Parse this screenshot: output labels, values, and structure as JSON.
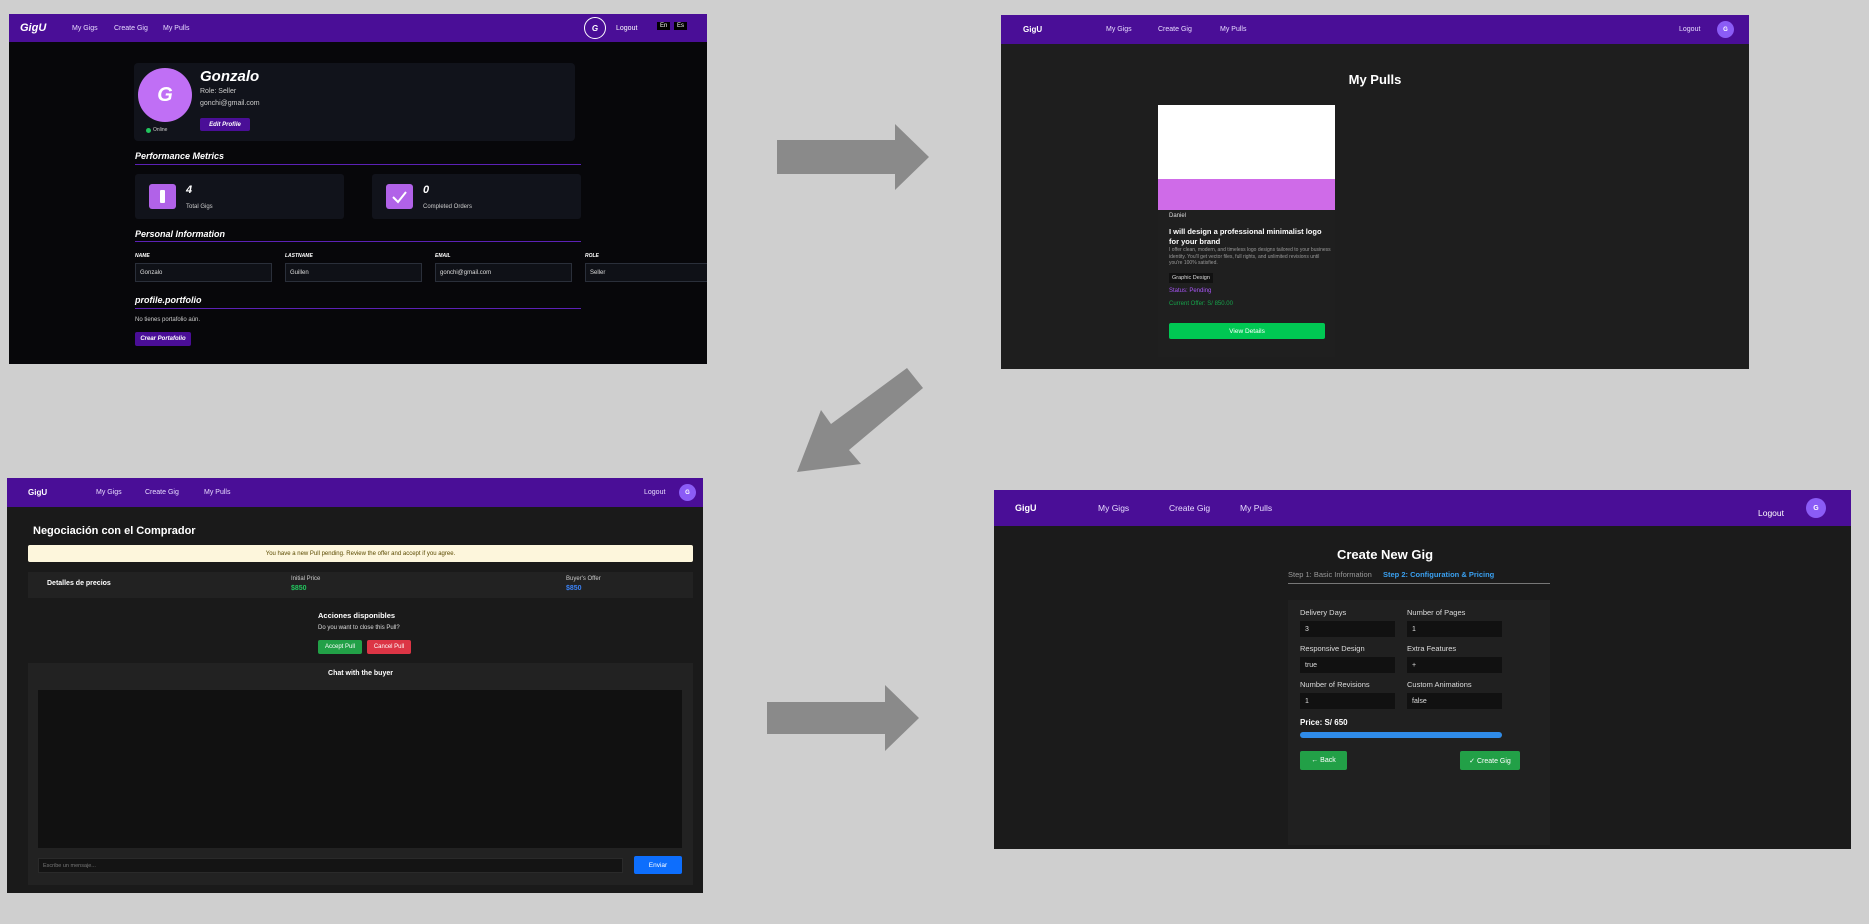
{
  "panel1": {
    "brand": "GigU",
    "nav": [
      "My Gigs",
      "Create Gig",
      "My Pulls"
    ],
    "avatar_letter": "G",
    "logout": "Logout",
    "lang_en": "En",
    "lang_es": "Es",
    "profile": {
      "avatar_letter": "G",
      "name": "Gonzalo",
      "role": "Role: Seller",
      "email": "gonchi@gmail.com",
      "status": "Online",
      "edit_button": "Edit Profile"
    },
    "metrics_title": "Performance Metrics",
    "metrics": [
      {
        "value": "4",
        "label": "Total Gigs"
      },
      {
        "value": "0",
        "label": "Completed Orders"
      }
    ],
    "personal_title": "Personal Information",
    "fields": [
      {
        "label": "NAME",
        "value": "Gonzalo"
      },
      {
        "label": "LASTNAME",
        "value": "Guillen"
      },
      {
        "label": "EMAIL",
        "value": "gonchi@gmail.com"
      },
      {
        "label": "ROLE",
        "value": "Seller"
      }
    ],
    "portfolio_title": "profile.portfolio",
    "portfolio_empty": "No tienes portafolio aún.",
    "portfolio_button": "Crear Portafolio"
  },
  "panel2": {
    "brand": "GigU",
    "nav": [
      "My Gigs",
      "Create Gig",
      "My Pulls"
    ],
    "logout": "Logout",
    "avatar_letter": "G",
    "title": "My Pulls",
    "card": {
      "seller": "Daniel",
      "title": "I will design a professional minimalist logo for your brand",
      "description": "I offer clean, modern, and timeless logo designs tailored to your business identity. You'll get vector files, full rights, and unlimited revisions until you're 100% satisfied.",
      "tag": "Graphic Design",
      "status": "Status: Pending",
      "offer": "Current Offer: S/ 850.00",
      "button": "View Details"
    }
  },
  "panel3": {
    "brand": "GigU",
    "nav": [
      "My Gigs",
      "Create Gig",
      "My Pulls"
    ],
    "logout": "Logout",
    "avatar_letter": "G",
    "title": "Negociación con el Comprador",
    "notice": "You have a new Pull pending. Review the offer and accept if you agree.",
    "pricing_label": "Detalles de precios",
    "initial_label": "Initial Price",
    "initial_value": "$850",
    "buyer_label": "Buyer's Offer",
    "buyer_value": "$850",
    "actions_title": "Acciones disponibles",
    "actions_question": "Do you want to close this Pull?",
    "accept": "Accept Pull",
    "cancel": "Cancel Pull",
    "chat_title": "Chat with the buyer",
    "chat_placeholder": "Escribe un mensaje...",
    "send": "Enviar"
  },
  "panel4": {
    "brand": "GigU",
    "nav": [
      "My Gigs",
      "Create Gig",
      "My Pulls"
    ],
    "logout": "Logout",
    "avatar_letter": "G",
    "title": "Create New Gig",
    "step1": "Step 1: Basic Information",
    "step2": "Step 2: Configuration & Pricing",
    "fields": [
      {
        "label": "Delivery Days",
        "value": "3"
      },
      {
        "label": "Number of Pages",
        "value": "1"
      },
      {
        "label": "Responsive Design",
        "value": "true"
      },
      {
        "label": "Extra Features",
        "value": "+"
      },
      {
        "label": "Number of Revisions",
        "value": "1"
      },
      {
        "label": "Custom Animations",
        "value": "false"
      }
    ],
    "price": "Price: S/ 650",
    "progress": 1.0,
    "back": "← Back",
    "create": "✓ Create Gig"
  },
  "colors": {
    "nav": "#4a0e97",
    "accent_purple": "#b162e8",
    "green": "#1db954",
    "blue": "#2f8be8"
  }
}
